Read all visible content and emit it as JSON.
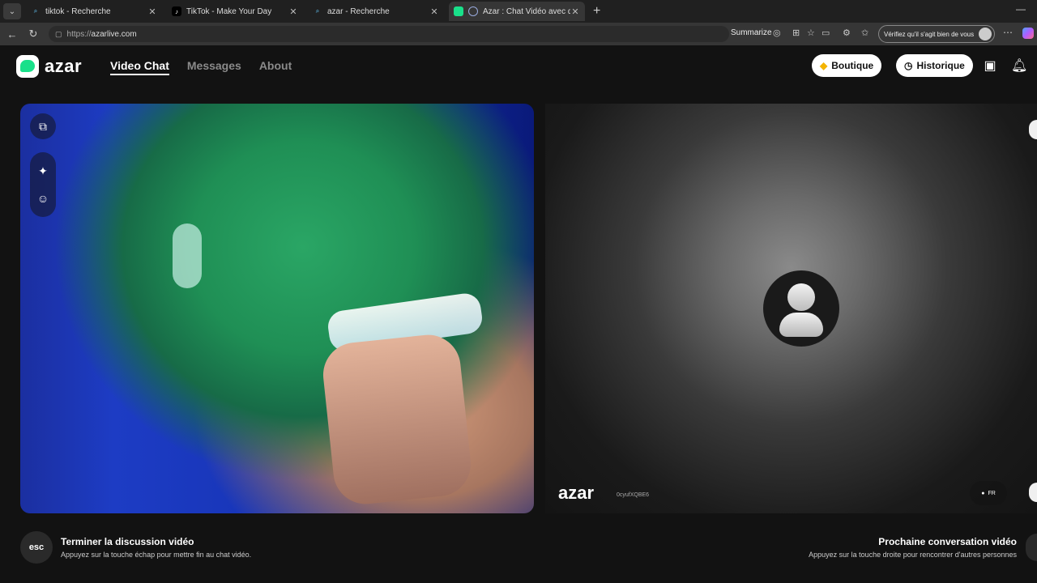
{
  "browser": {
    "tabs": [
      {
        "title": "tiktok - Recherche",
        "icon": "search-icon"
      },
      {
        "title": "TikTok - Make Your Day",
        "icon": "tiktok-icon"
      },
      {
        "title": "azar - Recherche",
        "icon": "search-icon"
      },
      {
        "title": "Azar : Chat Vidéo avec de no",
        "icon": "azar-icon"
      }
    ],
    "url_proto": "https://",
    "url_host": "azarlive.com",
    "summarize": "Summarize",
    "verify": "Vérifiez qu'il s'agit bien de vous"
  },
  "header": {
    "logo": "azar",
    "nav": [
      "Video Chat",
      "Messages",
      "About"
    ],
    "boutique": "Boutique",
    "historique": "Historique"
  },
  "remote": {
    "watermark": "azar",
    "user_id": "0cyufXQBE6",
    "country": "FR"
  },
  "footer": {
    "esc_key": "esc",
    "end_title": "Terminer la discussion vidéo",
    "end_desc": "Appuyez sur la touche échap pour mettre fin au chat vidéo.",
    "next_title": "Prochaine conversation vidéo",
    "next_desc": "Appuyez sur la touche droite pour rencontrer d'autres personnes"
  }
}
